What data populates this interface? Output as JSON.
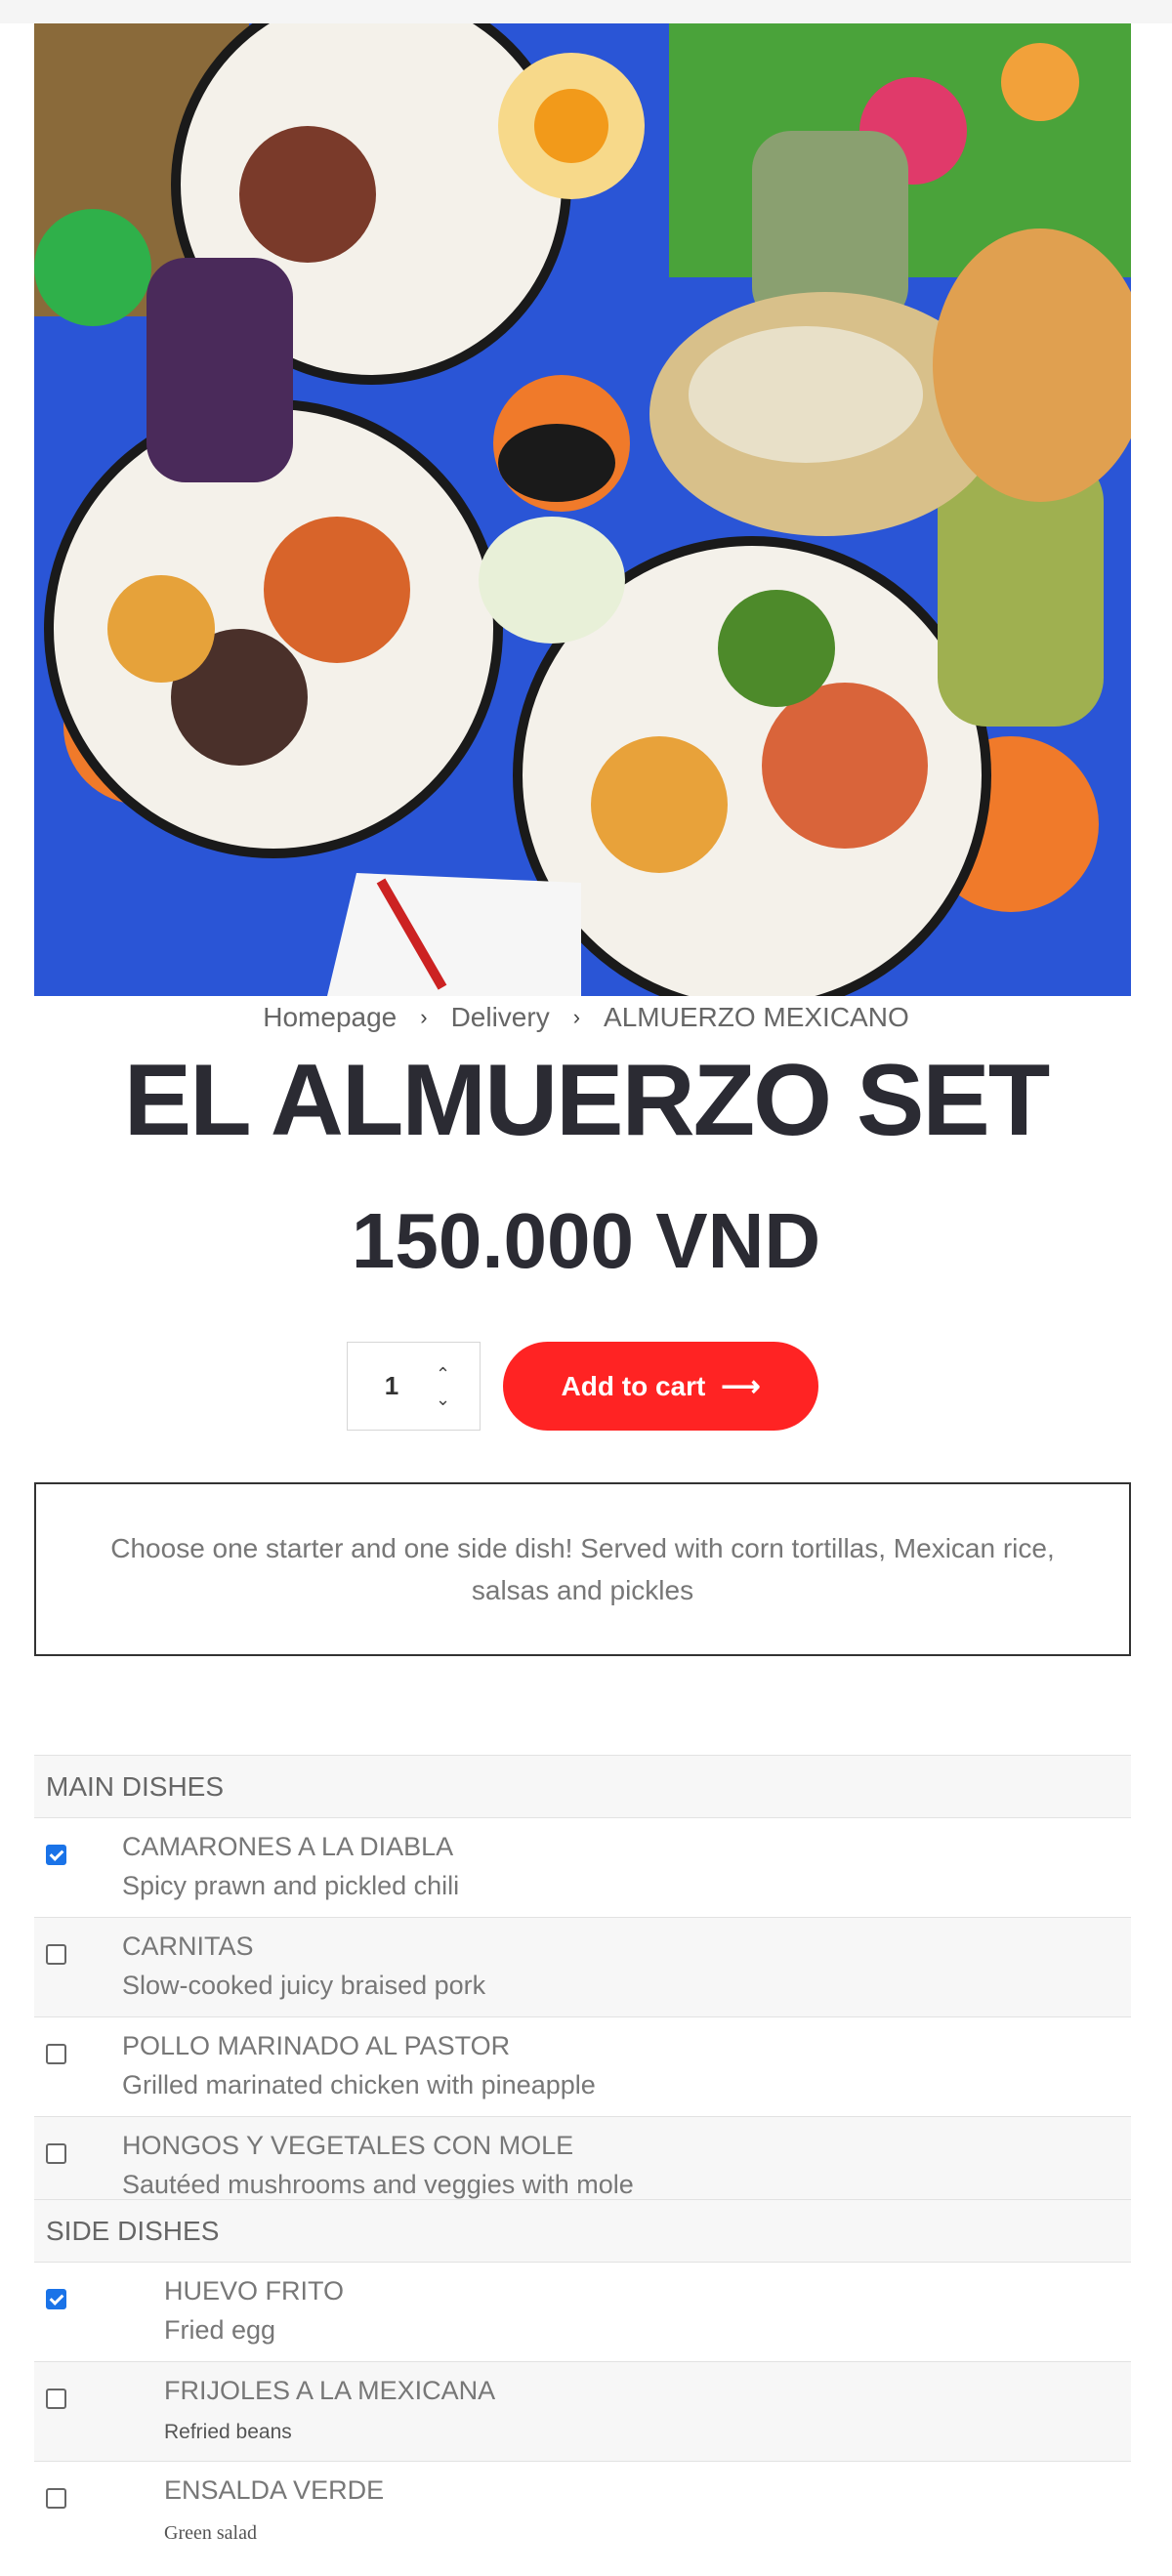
{
  "breadcrumb": {
    "items": [
      "Homepage",
      "Delivery",
      "ALMUERZO MEXICANO"
    ],
    "separator": "›"
  },
  "product": {
    "title": "EL ALMUERZO SET",
    "price": "150.000 VND",
    "quantity": "1",
    "add_to_cart_label": "Add to cart",
    "add_to_cart_icon": "arrow-right-icon",
    "description": "Choose one starter and one side dish! Served with corn tortillas, Mexican rice, salsas and pickles"
  },
  "main_dishes": {
    "heading": "MAIN DISHES",
    "items": [
      {
        "name": "CAMARONES A LA DIABLA",
        "desc": "Spicy prawn and pickled chili",
        "checked": true
      },
      {
        "name": "CARNITAS",
        "desc": "Slow-cooked juicy braised pork",
        "checked": false
      },
      {
        "name": "POLLO MARINADO AL PASTOR",
        "desc": "Grilled marinated chicken with pineapple",
        "checked": false
      },
      {
        "name": "HONGOS Y VEGETALES CON MOLE",
        "desc": "Sautéed mushrooms and veggies with mole",
        "checked": false
      }
    ]
  },
  "side_dishes": {
    "heading": "SIDE DISHES",
    "items": [
      {
        "name": "HUEVO FRITO",
        "desc": "Fried egg",
        "checked": true
      },
      {
        "name": "FRIJOLES A LA MEXICANA",
        "desc": "Refried beans",
        "checked": false
      },
      {
        "name": "ENSALDA VERDE",
        "desc": "Green salad",
        "checked": false
      }
    ]
  },
  "colors": {
    "accent": "#ff2323",
    "checkbox": "#1a73e8",
    "heading": "#2b2b33"
  }
}
